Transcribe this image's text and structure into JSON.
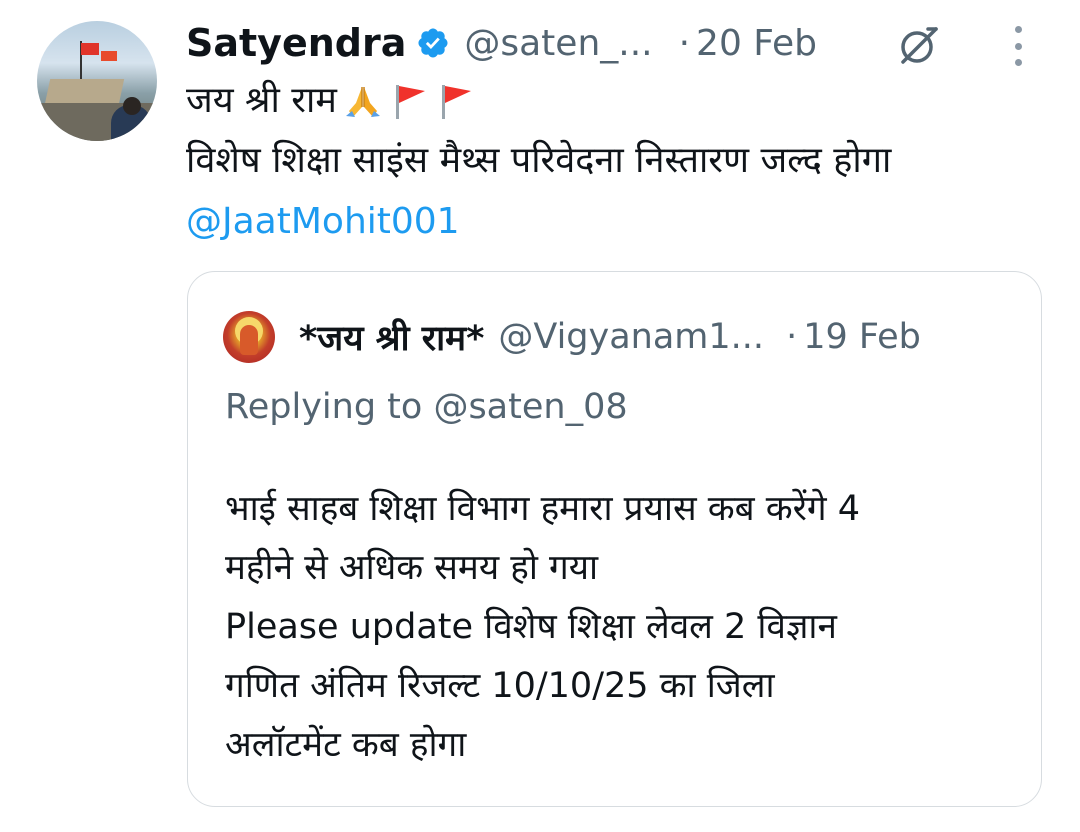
{
  "tweet": {
    "author_name": "Satyendra",
    "handle": "@saten_...",
    "separator": "·",
    "date": "20 Feb",
    "text_line1": "जय श्री राम",
    "text_line2": "विशेष शिक्षा साइंस मैथ्स परिवेदना निस्तारण जल्द होगा",
    "mention": "@JaatMohit001",
    "emojis": [
      "folded-hands-icon",
      "triangular-flag-icon",
      "triangular-flag-icon"
    ]
  },
  "quoted_tweet": {
    "author_name": "*जय श्री राम*",
    "handle": "@Vigyanam1...",
    "separator": "·",
    "date": "19 Feb",
    "replying_to": "Replying to @saten_08",
    "body_lines": [
      "भाई साहब शिक्षा विभाग हमारा प्रयास कब करेंगे 4",
      "महीने से अधिक समय हो गया",
      "Please update विशेष शिक्षा लेवल 2 विज्ञान",
      "गणित अंतिम रिजल्ट 10/10/25 का जिला",
      "अलॉटमेंट कब होगा"
    ]
  },
  "colors": {
    "text": "#0f1419",
    "secondary": "#536471",
    "link": "#1d9bf0",
    "verified": "#1d9bf0",
    "border": "#d7dce0"
  }
}
